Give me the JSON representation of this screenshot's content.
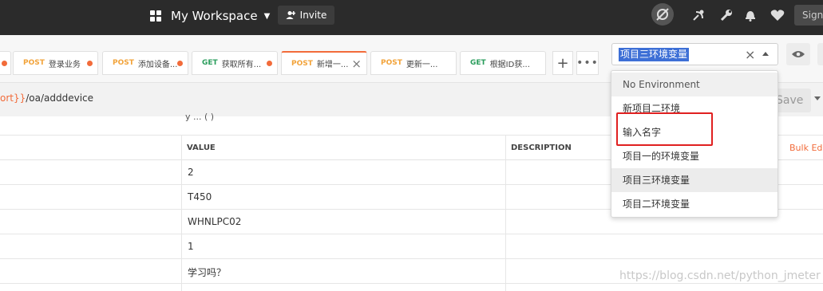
{
  "header": {
    "workspace": "My Workspace",
    "invite_label": "Invite",
    "sign_label": "Sign"
  },
  "tabs": [
    {
      "method": "POST",
      "title": "登录业务",
      "unsaved": true
    },
    {
      "method": "POST",
      "title": "添加设备...",
      "unsaved": true
    },
    {
      "method": "GET",
      "title": "获取所有...",
      "unsaved": true
    },
    {
      "method": "POST",
      "title": "新增一...",
      "active": true
    },
    {
      "method": "POST",
      "title": "更新一..."
    },
    {
      "method": "GET",
      "title": "根据ID获..."
    }
  ],
  "environment": {
    "selected": "项目三环境变量",
    "options": [
      "No Environment",
      "新项目二环境",
      "输入名字",
      "项目一的环境变量",
      "项目三环境变量",
      "项目二环境变量"
    ]
  },
  "request": {
    "url_var_fragment": "ort}}",
    "url_path": "/oa/adddevice",
    "save_label": "Save"
  },
  "table": {
    "partial_row_text": "y  ...  (  )",
    "columns": {
      "value": "VALUE",
      "description": "DESCRIPTION"
    },
    "bulk_edit": "Bulk Ed",
    "rows": [
      "2",
      "T450",
      "WHNLPC02",
      "1",
      "学习吗？"
    ]
  },
  "watermark": "https://blog.csdn.net/python_jmeter",
  "colors": {
    "accent": "#f26b3a",
    "post": "#f2a33a",
    "get": "#2a9d5c",
    "highlight": "#3d6fd6",
    "annotation": "#e02020"
  }
}
